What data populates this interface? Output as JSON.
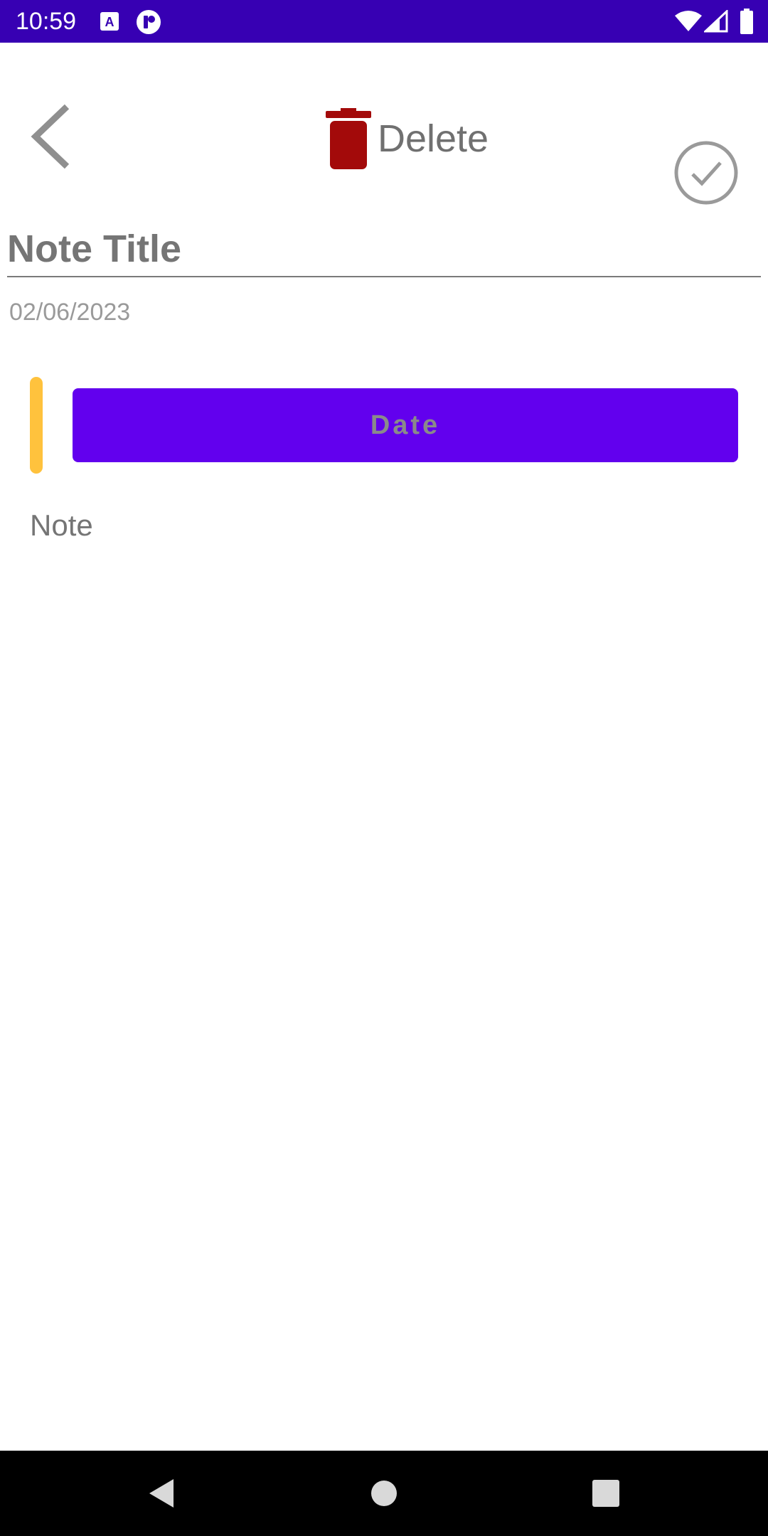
{
  "status_bar": {
    "time": "10:59",
    "background": "#3700b3",
    "icons": [
      "notification-a-icon",
      "app-notification-icon",
      "wifi-icon",
      "cell-signal-icon",
      "battery-icon"
    ]
  },
  "toolbar": {
    "back_icon": "chevron-left-icon",
    "delete_label": "Delete",
    "delete_icon": "trash-icon",
    "delete_icon_color": "#a30a0a",
    "done_icon": "check-circle-icon"
  },
  "note": {
    "title_placeholder": "Note Title",
    "date": "02/06/2023",
    "date_button_label": "Date",
    "body_placeholder": "Note"
  },
  "colors": {
    "indicator": "#ffc23d",
    "date_button": "#6200ee"
  },
  "nav_bar": {
    "icons": [
      "nav-back-icon",
      "nav-home-icon",
      "nav-recents-icon"
    ]
  }
}
